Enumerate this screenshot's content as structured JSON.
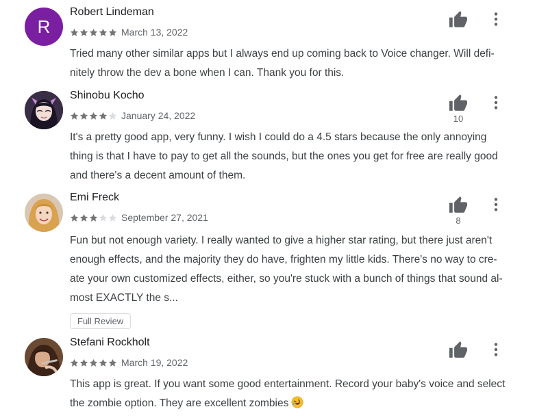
{
  "reviews": [
    {
      "author": "Robert Lindeman",
      "avatar_letter": "R",
      "avatar_color": "#7b1fa2",
      "rating": 5,
      "date": "March 13, 2022",
      "helpful_count": "",
      "lines": [
        "Tried many other similar apps but I always end up coming back to Voice changer. Will defi-",
        "nitely throw the dev a bone when I can. Thank you for this."
      ]
    },
    {
      "author": "Shinobu Kocho",
      "rating": 4,
      "date": "January 24, 2022",
      "helpful_count": "10",
      "lines": [
        "It's a pretty good app, very funny. I wish I could do a 4.5 stars because the only annoying",
        "thing is that I have to pay to get all the sounds, but the ones you get for free are really good",
        "and there's a decent amount of them."
      ]
    },
    {
      "author": "Emi Freck",
      "rating": 3,
      "date": "September 27, 2021",
      "helpful_count": "8",
      "lines": [
        "Fun but not enough variety. I really wanted to give a higher star rating, but there just aren't",
        "enough effects, and the majority they do have, frighten my little kids. There's no way to cre-",
        "ate your own customized effects, either, so you're stuck with a bunch of things that sound al-",
        "most EXACTLY the s..."
      ],
      "full_review_label": "Full Review"
    },
    {
      "author": "Stefani Rockholt",
      "rating": 5,
      "date": "March 19, 2022",
      "helpful_count": "",
      "lines": [
        "This app is great. If you want some good entertainment. Record your baby's voice and select",
        "the zombie option. They are excellent zombies"
      ],
      "emoji": "rolling-on-floor-laughing-emoji"
    }
  ],
  "colors": {
    "star_filled": "#757575",
    "star_empty": "#dadce0",
    "icon": "#5f6368"
  }
}
